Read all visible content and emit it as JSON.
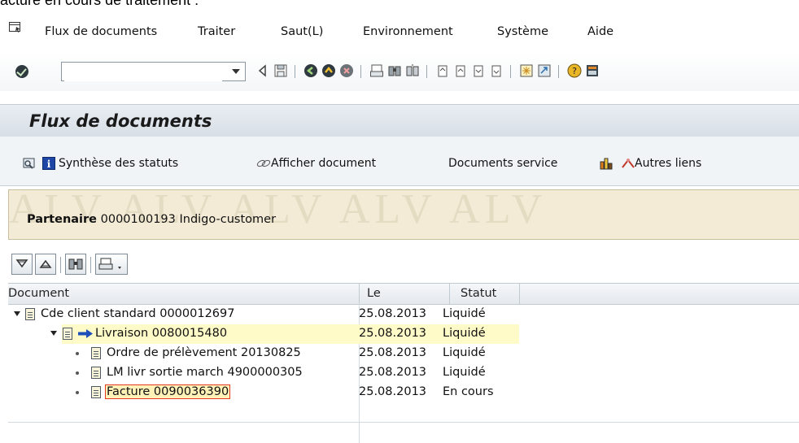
{
  "page_top_text": "acture en cours de traitement :",
  "menu": {
    "items": [
      "Flux de documents",
      "Traiter",
      "Saut(L)",
      "Environnement",
      "Système",
      "Aide"
    ]
  },
  "toolbar": {
    "command_field_value": ""
  },
  "title": "Flux de documents",
  "app_toolbar": {
    "status_overview_label": "Synthèse des statuts",
    "display_document_label": "Afficher document",
    "service_documents_label": "Documents service",
    "other_links_label": "Autres liens"
  },
  "header": {
    "partner_label": "Partenaire",
    "partner_value": "0000100193 Indigo-customer",
    "watermark": "ALV ALV ALV ALV ALV"
  },
  "grid": {
    "columns": [
      "Document",
      "Le",
      "Statut"
    ],
    "rows": [
      {
        "document": "Cde client standard 0000012697",
        "date": "25.08.2013",
        "status": "Liquidé"
      },
      {
        "document": "Livraison 0080015480",
        "date": "25.08.2013",
        "status": "Liquidé"
      },
      {
        "document": "Ordre de prélèvement 20130825",
        "date": "25.08.2013",
        "status": "Liquidé"
      },
      {
        "document": "LM livr sortie march 4900000305",
        "date": "25.08.2013",
        "status": "Liquidé"
      },
      {
        "document": "Facture 0090036390",
        "date": "25.08.2013",
        "status": "En cours"
      }
    ]
  },
  "colors": {
    "title_bg": "#dfe5eb",
    "header_bg": "#f3ebd6",
    "highlight_row": "#fffbc8",
    "focus_border": "#e53a1f"
  }
}
